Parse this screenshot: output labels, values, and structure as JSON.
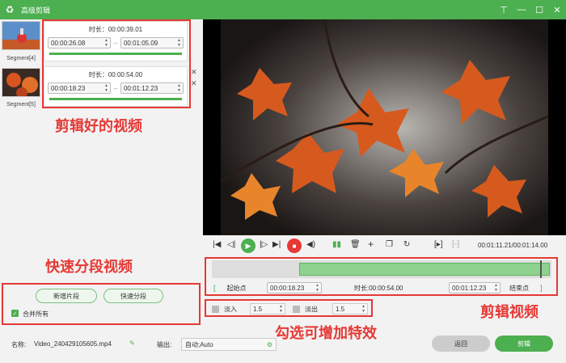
{
  "window": {
    "title": "高级剪辑"
  },
  "segments": [
    {
      "thumb_label": "Segment[4]",
      "duration": "时长：00:00:39.01",
      "start": "00:00:26.08",
      "end": "00:01:05.09",
      "progress": 1.0
    },
    {
      "thumb_label": "Segment[5]",
      "duration": "时长：00:00:54.00",
      "start": "00:00:18.23",
      "end": "00:01:12.23",
      "progress": 1.0
    }
  ],
  "annotations": {
    "clipped_videos": "剪辑好的视频",
    "quick_split": "快速分段视频",
    "clip_video": "剪辑视频",
    "effects": "勾选可增加特效"
  },
  "left_buttons": {
    "new_segment": "新增片段",
    "quick_split": "快速分段"
  },
  "merge_all": {
    "label": "合并所有",
    "checked": true
  },
  "footer": {
    "name_label": "名称:",
    "name_value": "Video_240429105605.mp4",
    "output_label": "输出:",
    "output_value": "自动;Auto",
    "back": "返回",
    "clip": "剪辑"
  },
  "player": {
    "time": "00:01:11.21/00:01:14.00"
  },
  "trim": {
    "start_btn": "起始点",
    "start_time": "00:00:18.23",
    "duration": "时长:00:00:54.00",
    "end_time": "00:01:12.23",
    "end_btn": "结束点"
  },
  "fade": {
    "in_label": "淡入",
    "in_value": "1.5",
    "out_label": "淡出",
    "out_value": "1.5"
  },
  "colors": {
    "accent": "#4caf50",
    "annotation": "#e53935"
  }
}
